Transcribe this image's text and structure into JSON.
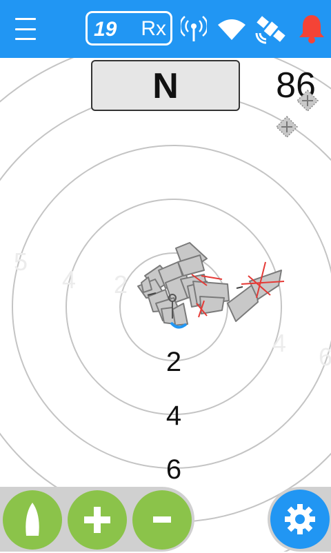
{
  "header": {
    "rx_count": "19",
    "rx_label": "Rx",
    "icons": [
      "menu-icon",
      "antenna-icon",
      "wifi-icon",
      "satellite-icon",
      "alarm-bell-icon"
    ]
  },
  "compass": {
    "label": "N"
  },
  "heading": {
    "value": "86"
  },
  "range_rings": {
    "labels": [
      "2",
      "4",
      "6"
    ]
  },
  "targets": {
    "count": 19,
    "symbol": "vessel-triangle"
  },
  "buttons": {
    "own_vessel": "boat-icon",
    "zoom_in": "plus-icon",
    "zoom_out": "minus-icon",
    "settings": "gear-icon"
  },
  "colors": {
    "accent": "#2196f3",
    "button_green": "#8bc34a",
    "alarm_red": "#f44336",
    "target_fill": "#c8c8c8",
    "target_cross": "#e53935"
  }
}
